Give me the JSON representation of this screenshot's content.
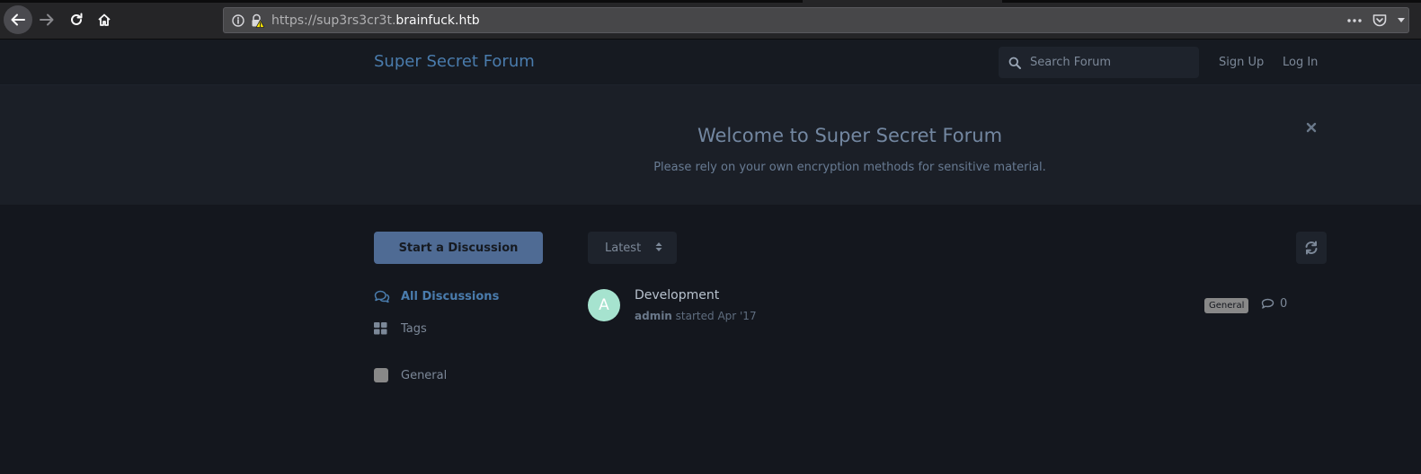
{
  "browser": {
    "url_prefix": "https://sup3rs3cr3t.",
    "url_host": "brainfuck.htb"
  },
  "header": {
    "title": "Super Secret Forum",
    "search_placeholder": "Search Forum",
    "signup_label": "Sign Up",
    "login_label": "Log In"
  },
  "hero": {
    "title": "Welcome to Super Secret Forum",
    "subtitle": "Please rely on your own encryption methods for sensitive material."
  },
  "sidebar": {
    "start_button": "Start a Discussion",
    "items": [
      {
        "label": "All Discussions",
        "icon": "comments-icon",
        "active": true
      },
      {
        "label": "Tags",
        "icon": "grid-icon",
        "active": false
      },
      {
        "label": "General",
        "icon": "tag-swatch",
        "color": "#888888",
        "active": false
      }
    ]
  },
  "toolbar": {
    "sort_label": "Latest"
  },
  "discussions": [
    {
      "avatar_letter": "A",
      "avatar_color": "#a6e3cf",
      "title": "Development",
      "author": "admin",
      "meta": " started Apr '17",
      "tag": "General",
      "replies": "0"
    }
  ],
  "colors": {
    "accent": "#4a7cad",
    "button": "#4f6b94",
    "background": "#14171e"
  }
}
